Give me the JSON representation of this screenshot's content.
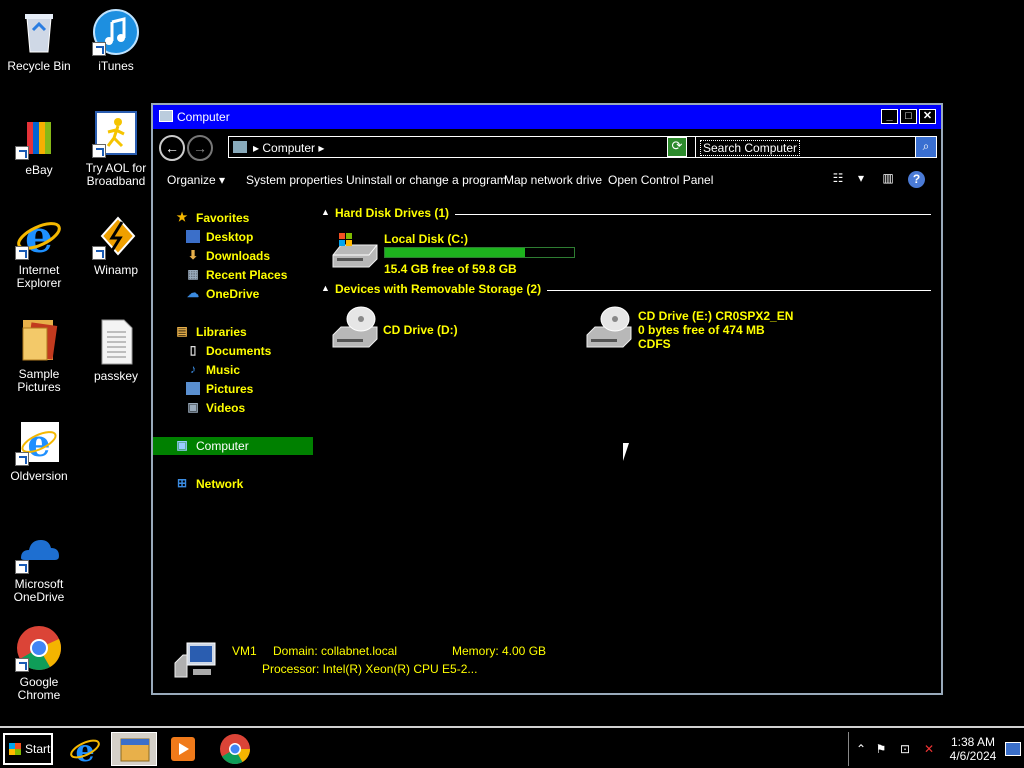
{
  "desktop": {
    "icons": [
      {
        "label": "Recycle Bin",
        "icon": "recycle-bin-icon"
      },
      {
        "label": "iTunes",
        "icon": "itunes-icon"
      },
      {
        "label": "eBay",
        "icon": "ebay-icon"
      },
      {
        "label": "Try AOL for Broadband",
        "icon": "aol-icon"
      },
      {
        "label": "Internet Explorer",
        "icon": "internet-explorer-icon"
      },
      {
        "label": "Winamp",
        "icon": "winamp-icon"
      },
      {
        "label": "Sample Pictures",
        "icon": "folder-icon"
      },
      {
        "label": "passkey",
        "icon": "text-file-icon"
      },
      {
        "label": "Oldversion",
        "icon": "internet-explorer-icon"
      },
      {
        "label": "Microsoft OneDrive",
        "icon": "onedrive-icon"
      },
      {
        "label": "Google Chrome",
        "icon": "chrome-icon"
      }
    ]
  },
  "window": {
    "title": "Computer",
    "address": {
      "crumb": "Computer"
    },
    "search": {
      "placeholder": "Search Computer"
    },
    "toolbar": {
      "organize": "Organize",
      "system_properties": "System properties",
      "uninstall": "Uninstall or change a program",
      "map_drive": "Map network drive",
      "control_panel": "Open Control Panel"
    },
    "nav": {
      "favorites": "Favorites",
      "desktop": "Desktop",
      "downloads": "Downloads",
      "recent_places": "Recent Places",
      "onedrive": "OneDrive",
      "libraries": "Libraries",
      "documents": "Documents",
      "music": "Music",
      "pictures": "Pictures",
      "videos": "Videos",
      "computer": "Computer",
      "network": "Network"
    },
    "groups": {
      "hdd": "Hard Disk Drives (1)",
      "removable": "Devices with Removable Storage (2)"
    },
    "drives": {
      "c": {
        "name": "Local Disk (C:)",
        "free": "15.4 GB free of 59.8 GB",
        "used_fraction": 0.74
      },
      "d": {
        "name": "CD Drive (D:)"
      },
      "e": {
        "name": "CD Drive (E:) CR0SPX2_EN",
        "free": "0 bytes free of 474 MB",
        "fs": "CDFS"
      }
    },
    "details": {
      "name": "VM1",
      "domain": "Domain: collabnet.local",
      "memory": "Memory: 4.00 GB",
      "processor": "Processor: Intel(R) Xeon(R) CPU E5-2..."
    }
  },
  "taskbar": {
    "start": "Start",
    "time": "1:38 AM",
    "date": "4/6/2024"
  },
  "colors": {
    "titlebar": "#0000ff",
    "nav_text": "#ffff00",
    "selected": "#008000",
    "progress": "#1db31d"
  }
}
